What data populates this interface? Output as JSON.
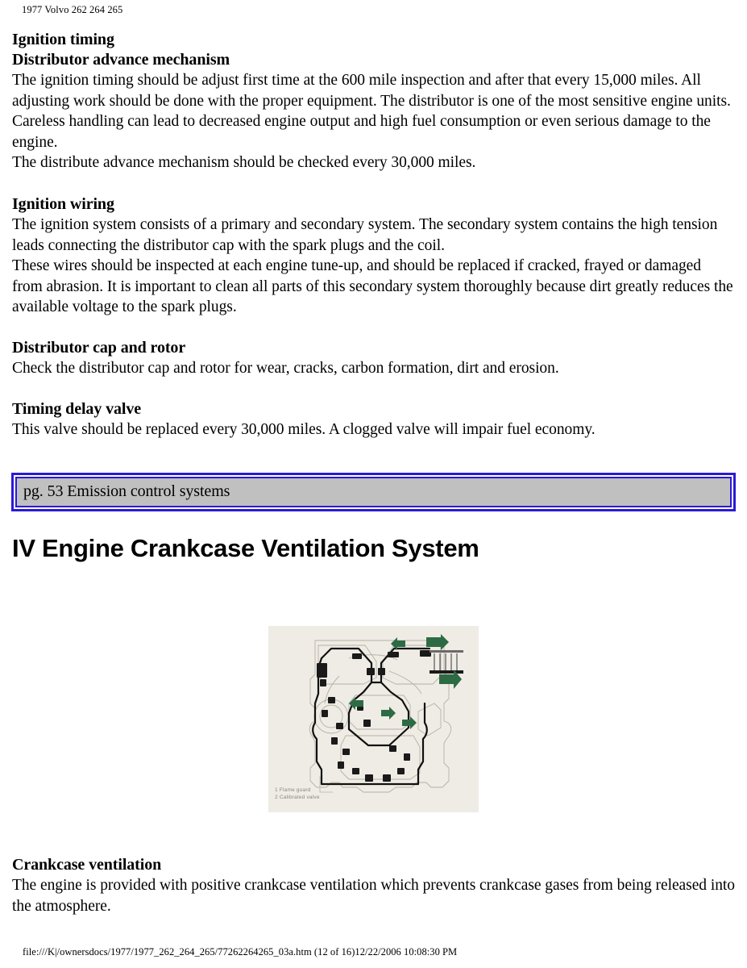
{
  "header": {
    "running_head": "1977 Volvo 262 264 265"
  },
  "sections": [
    {
      "heading": "Ignition timing",
      "subheading": "Distributor advance mechanism",
      "paragraphs": [
        "The ignition timing should be adjust first time at the 600 mile inspection and after that every 15,000 miles. All adjusting work should be done with the proper equipment. The distributor is one of the most sensitive engine units. Careless handling can lead to decreased engine output and high fuel consumption or even serious damage to the engine.",
        "The distribute advance mechanism should be checked every 30,000 miles."
      ]
    },
    {
      "heading": "Ignition wiring",
      "paragraphs": [
        "The ignition system consists of a primary and secondary system. The secondary system contains the high tension leads connecting the distributor cap with the spark plugs and the coil.",
        "These wires should be inspected at each engine tune-up, and should be replaced if cracked, frayed or damaged from abrasion. It is important to clean all parts of this secondary system thoroughly because dirt greatly reduces the available voltage to the spark plugs."
      ]
    },
    {
      "heading": "Distributor cap and rotor",
      "paragraphs": [
        "Check the distributor cap and rotor for wear, cracks, carbon formation, dirt and erosion."
      ]
    },
    {
      "heading": "Timing delay valve",
      "paragraphs": [
        "This valve should be replaced every 30,000 miles. A clogged valve will impair fuel economy."
      ]
    }
  ],
  "page_reference": {
    "text": "pg. 53 Emission control systems",
    "border_color": "#2a1ad6",
    "fill_color": "#c0c0c0"
  },
  "main_title": "IV Engine Crankcase Ventilation System",
  "figure": {
    "alt": "Engine crankcase ventilation system diagram",
    "background_color": "#efece5",
    "arrow_color": "#2d6b45",
    "caption_lines": [
      "1 Flame guard",
      "2 Calibrated valve"
    ]
  },
  "lower_section": {
    "heading": "Crankcase ventilation",
    "paragraphs": [
      "The engine is provided with positive crankcase ventilation which prevents crankcase gases from being released into the atmosphere."
    ]
  },
  "footer": {
    "path_text": "file:///K|/ownersdocs/1977/1977_262_264_265/77262264265_03a.htm (12 of 16)12/22/2006 10:08:30 PM"
  }
}
